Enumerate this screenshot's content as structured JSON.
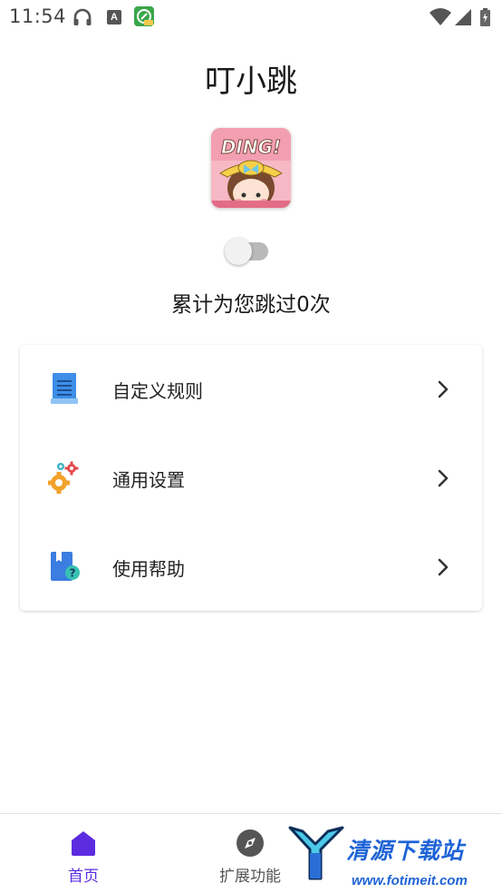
{
  "status_bar": {
    "time": "11:54",
    "icons": [
      "headset-icon",
      "a-badge-icon",
      "app-notification-icon",
      "wifi-icon",
      "signal-icon",
      "battery-icon"
    ]
  },
  "header": {
    "title": "叮小跳",
    "logo_text": "DING!"
  },
  "toggle": {
    "state": "off"
  },
  "stats": {
    "skip_count_text": "累计为您跳过0次"
  },
  "menu": {
    "items": [
      {
        "label": "自定义规则",
        "icon": "rules-document-icon"
      },
      {
        "label": "通用设置",
        "icon": "gears-icon"
      },
      {
        "label": "使用帮助",
        "icon": "help-book-icon"
      }
    ]
  },
  "bottom_nav": {
    "tabs": [
      {
        "label": "首页",
        "icon": "home-icon",
        "active": true
      },
      {
        "label": "扩展功能",
        "icon": "compass-icon",
        "active": false
      }
    ]
  },
  "watermark": {
    "brand": "清源下载站",
    "url": "www.fotimeit.com"
  },
  "colors": {
    "accent": "#5b2be0",
    "text": "#222222",
    "toggle_track": "#b9b9b9",
    "watermark": "#1e63d6"
  }
}
